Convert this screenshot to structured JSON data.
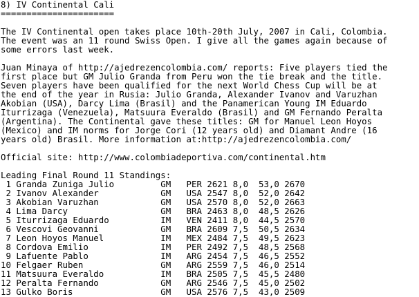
{
  "heading": "8) IV Continental Cali",
  "underline": "======================",
  "intro_lines": [
    "The IV Continental open takes place 10th-20th July, 2007 in Cali, Colombia.",
    "The event was an 11 round Swiss Open. I give all the games again because of",
    "some errors last week."
  ],
  "report_lines": [
    "Juan Minaya of http://ajedrezencolombia.com/ reports: Five players tied the",
    "first place but GM Julio Granda from Peru won the tie break and the title.",
    "Seven players have been qualified for the next World Chess Cup will be at",
    "the end of the year in Rusia: Julio Granda, Alexander Ivanov and Varuzhan",
    "Akobian (USA), Darcy Lima (Brasil) and the Panamerican Young IM Eduardo",
    "Iturrizaga (Venezuela), Matsuura Everaldo (Brasil) and GM Fernando Peralta",
    "(Argentina). The Continental gave these titles: GM for Manuel Leon Hoyos",
    "(Mexico) and IM norms for Jorge Cori (12 years old) and Diamant Andre (16",
    "years old) Brasil. More information at:http://ajedrezencolombia.com/"
  ],
  "official_site": "Official site: http://www.colombiadeportiva.com/continental.htm",
  "standings_title": "Leading Final Round 11 Standings:",
  "standings": [
    " 1 Granda Zuniga Julio         GM   PER 2621 8,0  53,0 2670",
    " 2 Ivanov Alexander            GM   USA 2547 8,0  52,0 2642",
    " 3 Akobian Varuzhan            GM   USA 2570 8,0  52,0 2663",
    " 4 Lima Darcy                  GM   BRA 2463 8,0  48,5 2626",
    " 5 Iturrizaga Eduardo          IM   VEN 2411 8,0  44,5 2570",
    " 6 Vescovi Geovanni            GM   BRA 2609 7,5  50,5 2634",
    " 7 Leon Hoyos Manuel           IM   MEX 2484 7,5  49,5 2623",
    " 8 Cordova Emilio              IM   PER 2492 7,5  48,5 2568",
    " 9 Lafuente Pablo              IM   ARG 2454 7,5  46,5 2552",
    "10 Felgaer Ruben               GM   ARG 2559 7,5  46,0 2514",
    "11 Matsuura Everaldo           IM   BRA 2505 7,5  45,5 2480",
    "12 Peralta Fernando            GM   ARG 2546 7,5  45,0 2502",
    "13 Gulko Boris                 GM   USA 2576 7,5  43,0 2509"
  ]
}
